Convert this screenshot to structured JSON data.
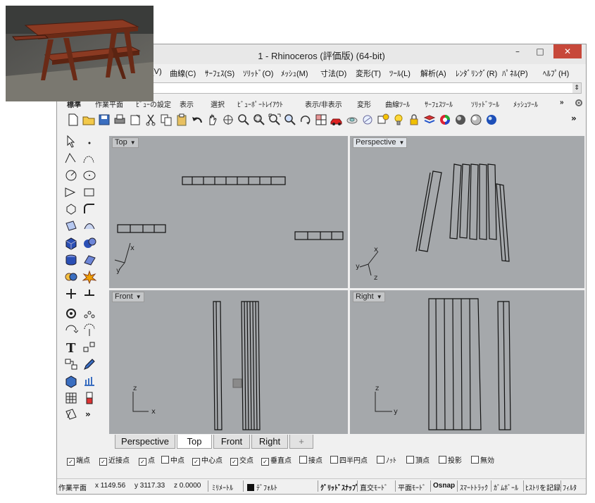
{
  "window": {
    "title": "1 - Rhinoceros (評価版) (64-bit)",
    "minimize": "–",
    "maximize": "□",
    "close": "✕"
  },
  "menu": [
    "(V)",
    "曲線(C)",
    "ｻｰﾌｪｽ(S)",
    "ｿﾘｯﾄﾞ(O)",
    "ﾒｯｼｭ(M)",
    "寸法(D)",
    "変形(T)",
    "ﾂｰﾙ(L)",
    "解析(A)",
    "ﾚﾝﾀﾞﾘﾝｸﾞ(R)",
    "ﾊﾟﾈﾙ(P)",
    "ﾍﾙﾌﾟ(H)"
  ],
  "toolbar_tabs": [
    "標準",
    "作業平面",
    "ﾋﾞｭｰの設定",
    "表示",
    "選択",
    "ﾋﾞｭｰﾎﾟｰﾄﾚｲｱｳﾄ",
    "表示/非表示",
    "変形",
    "曲線ﾂｰﾙ",
    "ｻｰﾌｪｽﾂｰﾙ",
    "ｿﾘｯﾄﾞﾂｰﾙ",
    "ﾒｯｼｭﾂｰﾙ",
    "»"
  ],
  "toolbar_more": "»",
  "viewports": {
    "top": {
      "label": "Top"
    },
    "perspective": {
      "label": "Perspective"
    },
    "front": {
      "label": "Front"
    },
    "right": {
      "label": "Right"
    }
  },
  "axes": {
    "x": "x",
    "y": "y",
    "z": "z"
  },
  "viewport_tabs": [
    "Perspective",
    "Top",
    "Front",
    "Right",
    "+"
  ],
  "active_viewport_tab": "Top",
  "osnaps": [
    {
      "label": "端点",
      "checked": true
    },
    {
      "label": "近接点",
      "checked": true
    },
    {
      "label": "点",
      "checked": true
    },
    {
      "label": "中点",
      "checked": false
    },
    {
      "label": "中心点",
      "checked": true
    },
    {
      "label": "交点",
      "checked": true
    },
    {
      "label": "垂直点",
      "checked": true
    },
    {
      "label": "接点",
      "checked": false
    },
    {
      "label": "四半円点",
      "checked": false
    },
    {
      "label": "ﾉｯﾄ",
      "checked": false
    },
    {
      "label": "頂点",
      "checked": false
    },
    {
      "label": "投影",
      "checked": false
    },
    {
      "label": "無効",
      "checked": false
    }
  ],
  "status": {
    "plane": "作業平面",
    "x": "x 1149.56",
    "y": "y 3117.33",
    "z": "z 0.0000",
    "units": "ﾐﾘﾒｰﾄﾙ",
    "layer": "ﾃﾞﾌｫﾙﾄ",
    "grid_snap": "ｸﾞﾘｯﾄﾞｽﾅｯﾌﾟ",
    "ortho": "直交ﾓｰﾄﾞ",
    "planar": "平面ﾓｰﾄﾞ",
    "osnap": "Osnap",
    "smarttrack": "ｽﾏｰﾄﾄﾗｯｸ",
    "gumball": "ｶﾞﾑﾎﾞｰﾙ",
    "history": "ﾋｽﾄﾘを記録",
    "filter": "ﾌｨﾙﾀ"
  },
  "colors": {
    "viewport_bg": "#a5a8ab",
    "close_button": "#c7483a",
    "selection_blue": "#2a66c8"
  }
}
